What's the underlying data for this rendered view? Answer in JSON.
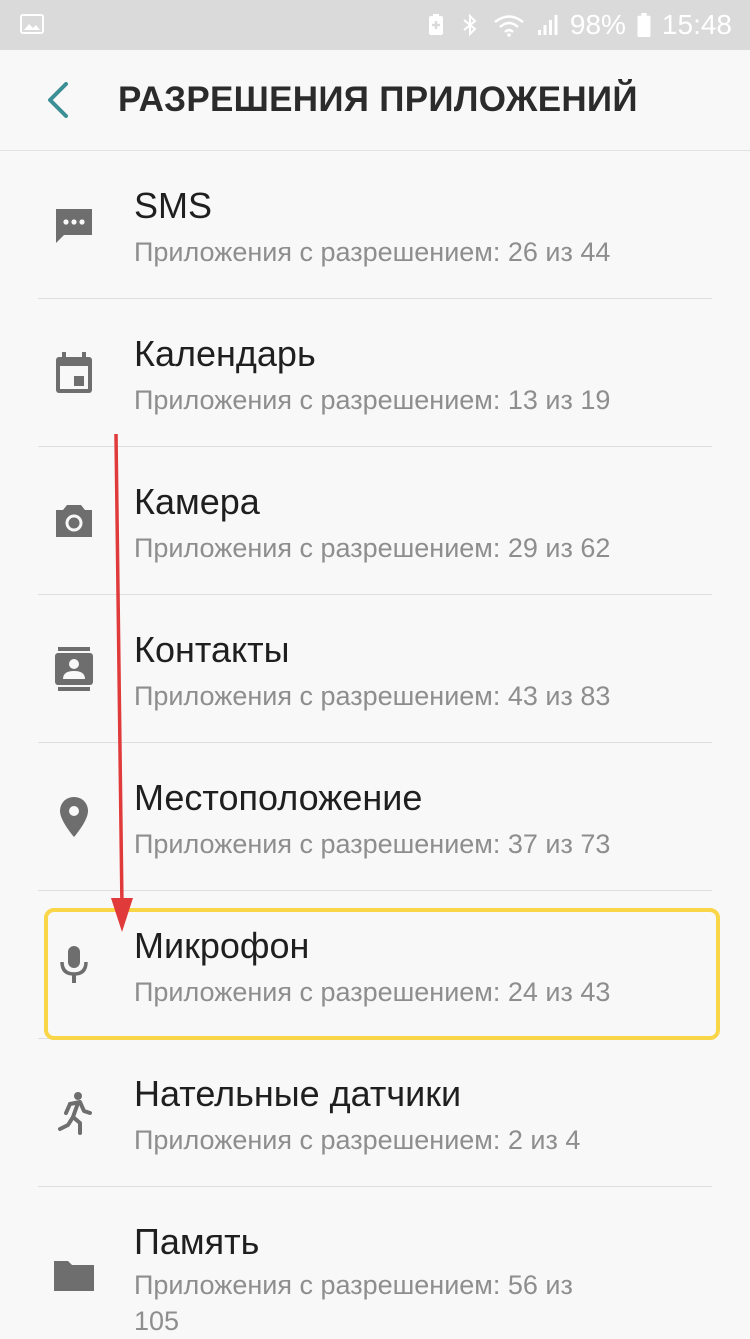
{
  "status_bar": {
    "battery": "98%",
    "time": "15:48"
  },
  "header": {
    "title": "РАЗРЕШЕНИЯ ПРИЛОЖЕНИЙ"
  },
  "permissions": [
    {
      "icon": "sms-icon",
      "title": "SMS",
      "subtitle": "Приложения с разрешением: 26 из 44"
    },
    {
      "icon": "calendar-icon",
      "title": "Календарь",
      "subtitle": "Приложения с разрешением: 13 из 19"
    },
    {
      "icon": "camera-icon",
      "title": "Камера",
      "subtitle": "Приложения с разрешением: 29 из 62"
    },
    {
      "icon": "contacts-icon",
      "title": "Контакты",
      "subtitle": "Приложения с разрешением: 43 из 83"
    },
    {
      "icon": "location-icon",
      "title": "Местоположение",
      "subtitle": "Приложения с разрешением: 37 из 73"
    },
    {
      "icon": "microphone-icon",
      "title": "Микрофон",
      "subtitle": "Приложения с разрешением: 24 из 43"
    },
    {
      "icon": "body-sensors-icon",
      "title": "Нательные датчики",
      "subtitle": "Приложения с разрешением: 2 из 4"
    },
    {
      "icon": "folder-icon",
      "title": "Память",
      "subtitle": "Приложения с разрешением: 56 из 105"
    }
  ],
  "colors": {
    "accent": "#3c8f96",
    "highlight": "#f9d648",
    "arrow": "#e03a3a",
    "icon": "#6e6e6e"
  }
}
